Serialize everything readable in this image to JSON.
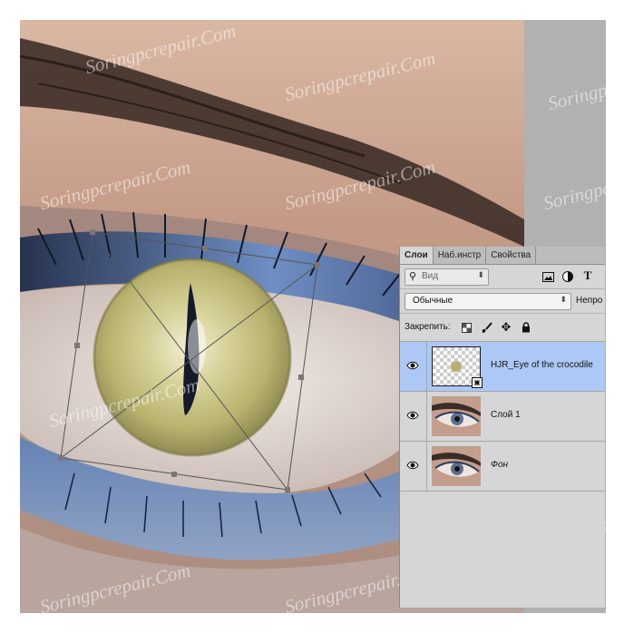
{
  "panel": {
    "tabs": [
      {
        "label": "Слои",
        "active": true
      },
      {
        "label": "Наб.инстр",
        "active": false
      },
      {
        "label": "Свойства",
        "active": false
      }
    ],
    "filter_placeholder": "Вид",
    "blend_mode": "Обычные",
    "opacity_label": "Непро",
    "lock_label": "Закрепить:",
    "layers": [
      {
        "name": "HJR_Eye of the crocodile",
        "selected": true,
        "italic": false,
        "smart_object": true
      },
      {
        "name": "Слой 1",
        "selected": false,
        "italic": false
      },
      {
        "name": "Фон",
        "selected": false,
        "italic": true
      }
    ]
  },
  "watermark_text": "Soringpcrepair.Com",
  "colors": {
    "panel_bg": "#d6d6d6",
    "selected_row": "#adc8f5",
    "canvas_gray": "#b1b1b1",
    "eyeshadow_blue": "#4a6a9c",
    "iris_yellow": "#c9c486"
  },
  "icons": [
    "search-icon",
    "image-filter-icon",
    "adjustment-filter-icon",
    "type-filter-icon",
    "lock-transparency-icon",
    "lock-brush-icon",
    "lock-move-icon",
    "lock-all-icon",
    "eye-icon",
    "smart-object-icon"
  ]
}
